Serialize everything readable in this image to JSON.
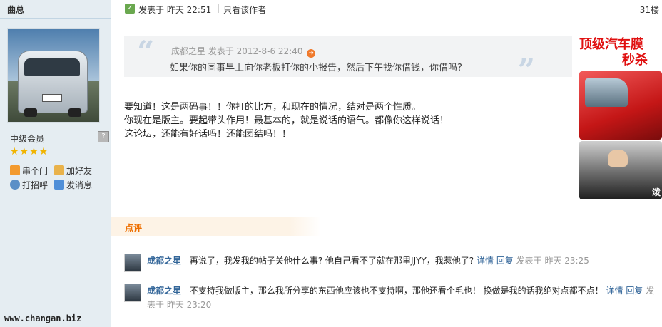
{
  "author": {
    "name": "曲总",
    "rank": "中级会员",
    "stars": "★★★★",
    "actions": [
      "串个门",
      "加好友",
      "打招呼",
      "发消息"
    ]
  },
  "post": {
    "posted_at": "发表于 昨天 22:51",
    "separator": "|",
    "only_author": "只看该作者",
    "floor": "31楼",
    "quote": {
      "meta": "成都之星 发表于 2012-8-6 22:40",
      "text": "如果你的同事早上向你老板打你的小报告，然后下午找你借钱，你借吗?"
    },
    "body": [
      "要知道！这是两码事！！你打的比方，和现在的情况，结对是两个性质。",
      "你现在是版主。要起带头作用！最基本的，就是说话的语气。都像你这样说话！",
      "这论坛，还能有好话吗！还能团结吗！！"
    ]
  },
  "ad": {
    "line1": "顶级汽车膜",
    "line2": "秒杀",
    "corner": "泼"
  },
  "comments_tab": "点评",
  "comments": [
    {
      "user": "成都之星",
      "text": "再说了，我发我的帖子关他什么事? 他自己看不了就在那里JJYY，我惹他了?",
      "detail": "详情",
      "reply": "回复",
      "date": "发表于 昨天 23:25"
    },
    {
      "user": "成都之星",
      "text": "不支持我做版主，那么我所分享的东西他应该也不支持啊，那他还看个毛也！ 换做是我的话我绝对点都不点！",
      "detail": "详情",
      "reply": "回复",
      "date": "发表于 昨天 23:20"
    }
  ],
  "site_url": "www.changan.biz"
}
